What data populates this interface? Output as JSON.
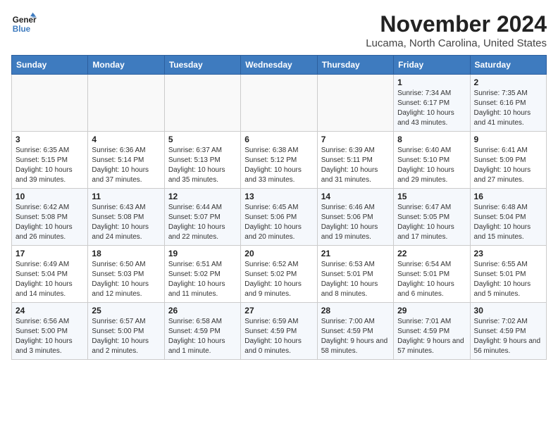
{
  "header": {
    "logo_line1": "General",
    "logo_line2": "Blue",
    "month": "November 2024",
    "location": "Lucama, North Carolina, United States"
  },
  "weekdays": [
    "Sunday",
    "Monday",
    "Tuesday",
    "Wednesday",
    "Thursday",
    "Friday",
    "Saturday"
  ],
  "weeks": [
    [
      {
        "day": "",
        "info": ""
      },
      {
        "day": "",
        "info": ""
      },
      {
        "day": "",
        "info": ""
      },
      {
        "day": "",
        "info": ""
      },
      {
        "day": "",
        "info": ""
      },
      {
        "day": "1",
        "info": "Sunrise: 7:34 AM\nSunset: 6:17 PM\nDaylight: 10 hours and 43 minutes."
      },
      {
        "day": "2",
        "info": "Sunrise: 7:35 AM\nSunset: 6:16 PM\nDaylight: 10 hours and 41 minutes."
      }
    ],
    [
      {
        "day": "3",
        "info": "Sunrise: 6:35 AM\nSunset: 5:15 PM\nDaylight: 10 hours and 39 minutes."
      },
      {
        "day": "4",
        "info": "Sunrise: 6:36 AM\nSunset: 5:14 PM\nDaylight: 10 hours and 37 minutes."
      },
      {
        "day": "5",
        "info": "Sunrise: 6:37 AM\nSunset: 5:13 PM\nDaylight: 10 hours and 35 minutes."
      },
      {
        "day": "6",
        "info": "Sunrise: 6:38 AM\nSunset: 5:12 PM\nDaylight: 10 hours and 33 minutes."
      },
      {
        "day": "7",
        "info": "Sunrise: 6:39 AM\nSunset: 5:11 PM\nDaylight: 10 hours and 31 minutes."
      },
      {
        "day": "8",
        "info": "Sunrise: 6:40 AM\nSunset: 5:10 PM\nDaylight: 10 hours and 29 minutes."
      },
      {
        "day": "9",
        "info": "Sunrise: 6:41 AM\nSunset: 5:09 PM\nDaylight: 10 hours and 27 minutes."
      }
    ],
    [
      {
        "day": "10",
        "info": "Sunrise: 6:42 AM\nSunset: 5:08 PM\nDaylight: 10 hours and 26 minutes."
      },
      {
        "day": "11",
        "info": "Sunrise: 6:43 AM\nSunset: 5:08 PM\nDaylight: 10 hours and 24 minutes."
      },
      {
        "day": "12",
        "info": "Sunrise: 6:44 AM\nSunset: 5:07 PM\nDaylight: 10 hours and 22 minutes."
      },
      {
        "day": "13",
        "info": "Sunrise: 6:45 AM\nSunset: 5:06 PM\nDaylight: 10 hours and 20 minutes."
      },
      {
        "day": "14",
        "info": "Sunrise: 6:46 AM\nSunset: 5:06 PM\nDaylight: 10 hours and 19 minutes."
      },
      {
        "day": "15",
        "info": "Sunrise: 6:47 AM\nSunset: 5:05 PM\nDaylight: 10 hours and 17 minutes."
      },
      {
        "day": "16",
        "info": "Sunrise: 6:48 AM\nSunset: 5:04 PM\nDaylight: 10 hours and 15 minutes."
      }
    ],
    [
      {
        "day": "17",
        "info": "Sunrise: 6:49 AM\nSunset: 5:04 PM\nDaylight: 10 hours and 14 minutes."
      },
      {
        "day": "18",
        "info": "Sunrise: 6:50 AM\nSunset: 5:03 PM\nDaylight: 10 hours and 12 minutes."
      },
      {
        "day": "19",
        "info": "Sunrise: 6:51 AM\nSunset: 5:02 PM\nDaylight: 10 hours and 11 minutes."
      },
      {
        "day": "20",
        "info": "Sunrise: 6:52 AM\nSunset: 5:02 PM\nDaylight: 10 hours and 9 minutes."
      },
      {
        "day": "21",
        "info": "Sunrise: 6:53 AM\nSunset: 5:01 PM\nDaylight: 10 hours and 8 minutes."
      },
      {
        "day": "22",
        "info": "Sunrise: 6:54 AM\nSunset: 5:01 PM\nDaylight: 10 hours and 6 minutes."
      },
      {
        "day": "23",
        "info": "Sunrise: 6:55 AM\nSunset: 5:01 PM\nDaylight: 10 hours and 5 minutes."
      }
    ],
    [
      {
        "day": "24",
        "info": "Sunrise: 6:56 AM\nSunset: 5:00 PM\nDaylight: 10 hours and 3 minutes."
      },
      {
        "day": "25",
        "info": "Sunrise: 6:57 AM\nSunset: 5:00 PM\nDaylight: 10 hours and 2 minutes."
      },
      {
        "day": "26",
        "info": "Sunrise: 6:58 AM\nSunset: 4:59 PM\nDaylight: 10 hours and 1 minute."
      },
      {
        "day": "27",
        "info": "Sunrise: 6:59 AM\nSunset: 4:59 PM\nDaylight: 10 hours and 0 minutes."
      },
      {
        "day": "28",
        "info": "Sunrise: 7:00 AM\nSunset: 4:59 PM\nDaylight: 9 hours and 58 minutes."
      },
      {
        "day": "29",
        "info": "Sunrise: 7:01 AM\nSunset: 4:59 PM\nDaylight: 9 hours and 57 minutes."
      },
      {
        "day": "30",
        "info": "Sunrise: 7:02 AM\nSunset: 4:59 PM\nDaylight: 9 hours and 56 minutes."
      }
    ]
  ]
}
